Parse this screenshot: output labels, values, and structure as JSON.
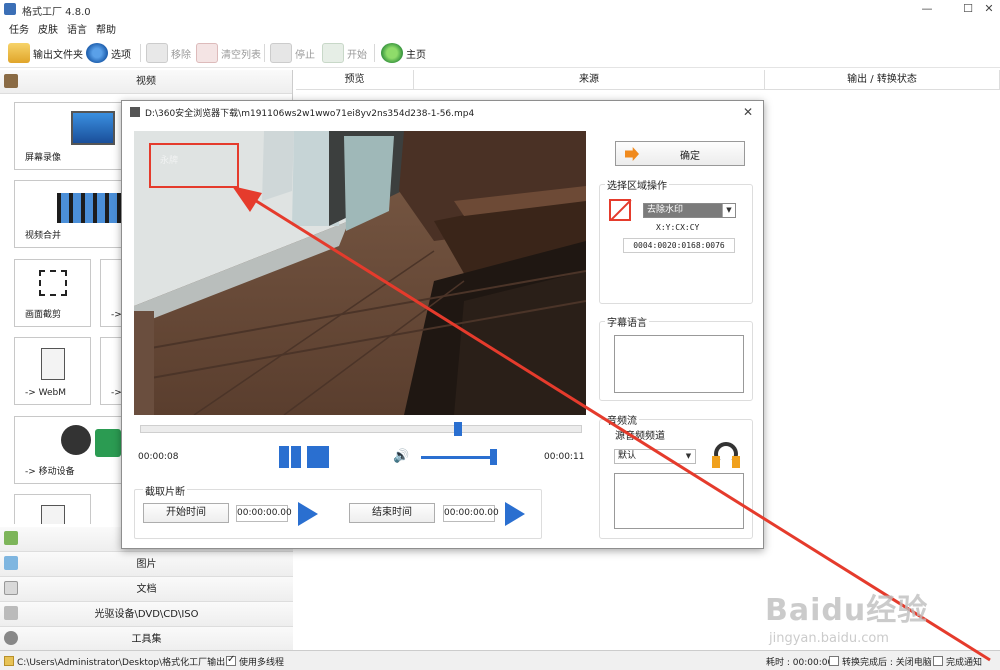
{
  "window": {
    "title": "格式工厂 4.8.0",
    "minimize": "—",
    "maximize": "☐",
    "close": "✕"
  },
  "menu": [
    "任务",
    "皮肤",
    "语言",
    "帮助"
  ],
  "toolbar": {
    "output_folder": "输出文件夹",
    "options": "选项",
    "remove": "移除",
    "clear_list": "清空列表",
    "stop": "停止",
    "start": "开始",
    "home": "主页"
  },
  "left": {
    "video_header": "视频",
    "tiles": [
      "屏幕录像",
      "视频合并",
      "画面截剪",
      "->",
      "-> WebM",
      "->",
      "-> 移动设备"
    ],
    "categories": [
      "图片",
      "文档",
      "光驱设备\\DVD\\CD\\ISO",
      "工具集"
    ]
  },
  "list_columns": [
    "预览",
    "来源",
    "输出 / 转换状态"
  ],
  "status": {
    "path": "C:\\Users\\Administrator\\Desktop\\格式化工厂输出",
    "multithread": "使用多线程",
    "elapsed": "耗时 : 00:00:00",
    "after_done": "转换完成后 : 关闭电脑",
    "notify": "完成通知"
  },
  "dialog": {
    "title": "D:\\360安全浏览器下载\\m191106ws2w1wwo71ei8yv2ns354d238-1-56.mp4",
    "close": "✕",
    "video_watermark": "永牌",
    "time_current": "00:00:08",
    "time_end": "00:00:11",
    "clip_section": "截取片断",
    "start_time_btn": "开始时间",
    "start_time_val": "00:00:00.00",
    "end_time_btn": "结束时间",
    "end_time_val": "00:00:00.00",
    "ok_btn": "确定",
    "region_section": "选择区域操作",
    "region_mode": "去除水印",
    "coord_label": "X:Y:CX:CY",
    "coord_value": "0004:0020:0168:0076",
    "subtitle_section": "字幕语言",
    "audio_section": "音频流",
    "audio_channel_label": "源音频频道",
    "audio_channel_value": "默认",
    "seek_position": 0.72,
    "volume_level": 1.0
  },
  "watermark": {
    "brand": "Baidu经验",
    "url": "jingyan.baidu.com"
  },
  "colors": {
    "accent_blue": "#2a6fd0",
    "annotation_red": "#e53b2c",
    "orange": "#f08a1e"
  }
}
